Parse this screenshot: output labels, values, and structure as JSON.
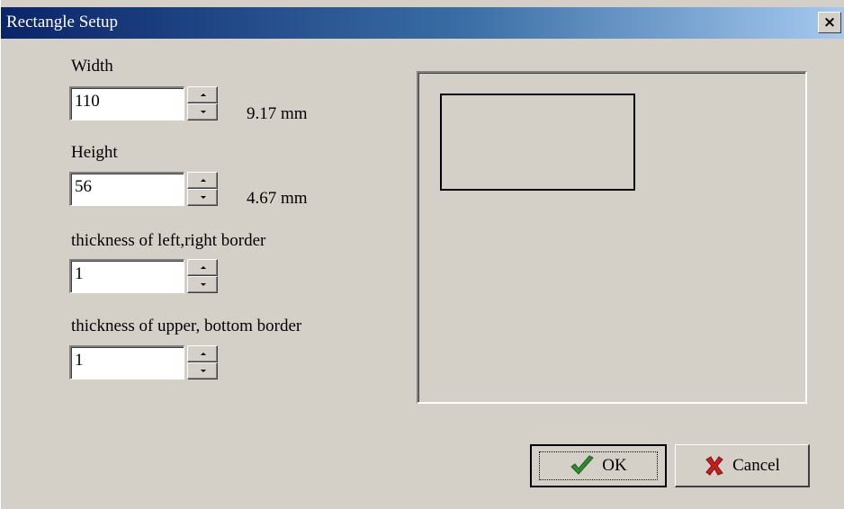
{
  "window": {
    "title": "Rectangle Setup",
    "close_glyph": "×"
  },
  "fields": [
    {
      "label": "Width",
      "value": "110",
      "unit_text": "9.17 mm"
    },
    {
      "label": "Height",
      "value": "56",
      "unit_text": "4.67 mm"
    },
    {
      "label": "thickness of left,right border",
      "value": "1"
    },
    {
      "label": "thickness of upper, bottom border",
      "value": "1"
    }
  ],
  "buttons": {
    "ok_label": "OK",
    "ok_icon": "checkmark-icon",
    "cancel_label": "Cancel",
    "cancel_icon": "x-mark-icon"
  },
  "colors": {
    "titlebar_start": "#0a246a",
    "titlebar_end": "#a6caf0",
    "dialog_bg": "#d4d0c8",
    "ok_icon_color": "#2e8b2e",
    "cancel_icon_color": "#c81e1e"
  }
}
